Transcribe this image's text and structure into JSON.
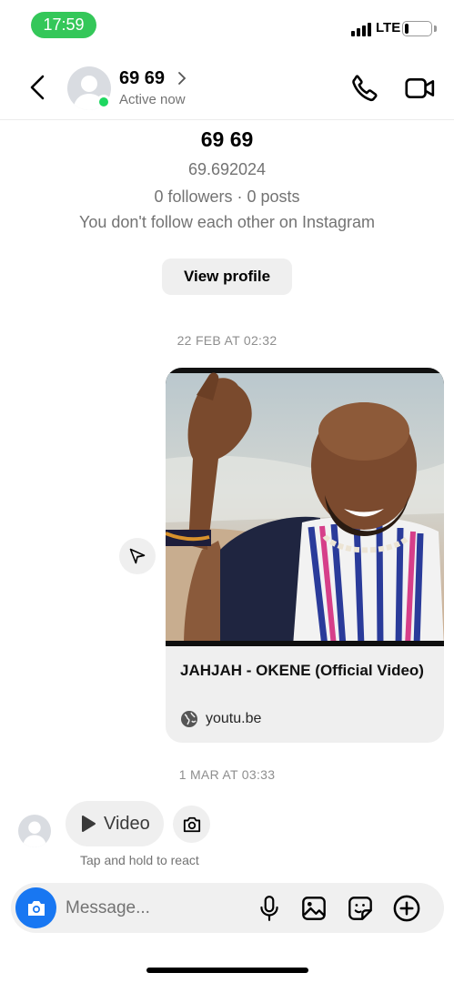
{
  "status_bar": {
    "time": "17:59",
    "network": "LTE",
    "battery_level": 0.15
  },
  "header": {
    "contact_name": "69 69",
    "presence": "Active now"
  },
  "profile": {
    "name": "69 69",
    "username": "69.692024",
    "stats": "0 followers · 0 posts",
    "follow_status": "You don't follow each other on Instagram",
    "view_profile_label": "View profile"
  },
  "messages": {
    "timestamp_1": "22 FEB AT 02:32",
    "shared_link": {
      "title": "JAHJAH - OKENE (Official Video)",
      "domain": "youtu.be"
    },
    "timestamp_2": "1 MAR AT 03:33",
    "video_label": "Video",
    "react_hint": "Tap and hold to react"
  },
  "composer": {
    "placeholder": "Message..."
  },
  "colors": {
    "online": "#1ed760",
    "status_pill": "#34c759",
    "accent": "#1877f2",
    "bubble": "#efefef"
  },
  "icons": [
    "back-chevron-icon",
    "phone-icon",
    "video-camera-icon",
    "send-icon",
    "globe-icon",
    "play-icon",
    "camera-icon",
    "microphone-icon",
    "gallery-icon",
    "sticker-icon",
    "plus-icon"
  ]
}
